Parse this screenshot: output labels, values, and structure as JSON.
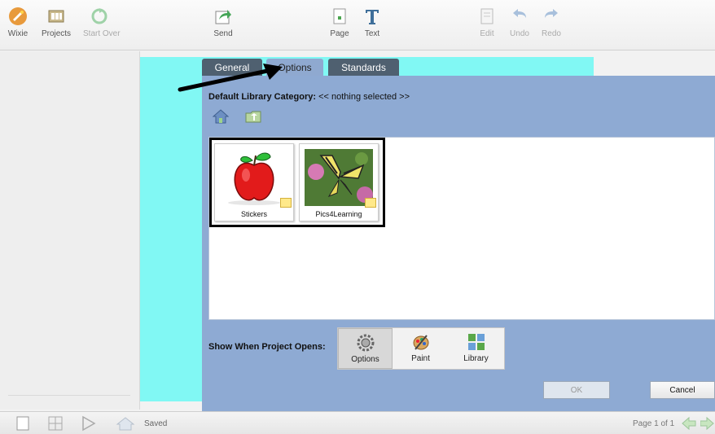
{
  "toolbar": {
    "wixie": "Wixie",
    "projects": "Projects",
    "start_over": "Start Over",
    "send": "Send",
    "page": "Page",
    "text": "Text",
    "edit": "Edit",
    "undo": "Undo",
    "redo": "Redo"
  },
  "dialog": {
    "tabs": [
      {
        "label": "General"
      },
      {
        "label": "Options"
      },
      {
        "label": "Standards"
      }
    ],
    "default_library_label": "Default Library Category:",
    "default_library_value": "<< nothing selected >>",
    "libraries": [
      {
        "caption": "Stickers",
        "icon": "apple-icon"
      },
      {
        "caption": "Pics4Learning",
        "icon": "butterfly-photo-icon"
      }
    ],
    "show_label": "Show When Project Opens:",
    "show_options": [
      {
        "label": "Options",
        "icon": "gear-icon",
        "selected": true
      },
      {
        "label": "Paint",
        "icon": "palette-icon",
        "selected": false
      },
      {
        "label": "Library",
        "icon": "library-grid-icon",
        "selected": false
      }
    ],
    "ok_label": "OK",
    "cancel_label": "Cancel"
  },
  "statusbar": {
    "status": "Saved",
    "page_info": "Page 1 of 1"
  },
  "colors": {
    "dialog_bg": "#8eaad3",
    "canvas_bg": "#81f8f4",
    "tab_dark": "#4f6070"
  }
}
